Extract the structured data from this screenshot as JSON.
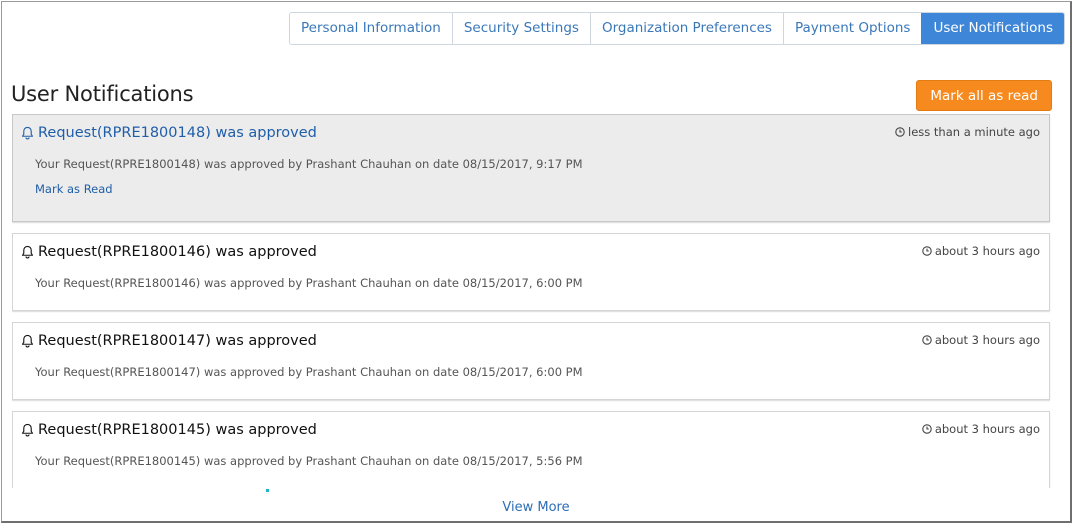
{
  "tabs": [
    {
      "label": "Personal Information",
      "active": false
    },
    {
      "label": "Security Settings",
      "active": false
    },
    {
      "label": "Organization Preferences",
      "active": false
    },
    {
      "label": "Payment Options",
      "active": false
    },
    {
      "label": "User Notifications",
      "active": true
    }
  ],
  "page": {
    "title": "User Notifications",
    "mark_all_label": "Mark all as read",
    "view_more_label": "View More"
  },
  "colors": {
    "accent_blue": "#3d86d8",
    "button_orange": "#f68a1f",
    "unread_bg": "#ececec",
    "link_blue": "#1f5ea8"
  },
  "notifications": [
    {
      "icon": "bell-icon",
      "title": "Request(RPRE1800148) was approved",
      "time": "less than a minute ago",
      "body": "Your Request(RPRE1800148) was approved by Prashant Chauhan on date 08/15/2017, 9:17 PM",
      "unread": true,
      "action": "Mark as Read"
    },
    {
      "icon": "bell-icon",
      "title": "Request(RPRE1800146) was approved",
      "time": "about 3 hours ago",
      "body": "Your Request(RPRE1800146) was approved by Prashant Chauhan on date 08/15/2017, 6:00 PM",
      "unread": false
    },
    {
      "icon": "bell-icon",
      "title": "Request(RPRE1800147) was approved",
      "time": "about 3 hours ago",
      "body": "Your Request(RPRE1800147) was approved by Prashant Chauhan on date 08/15/2017, 6:00 PM",
      "unread": false
    },
    {
      "icon": "bell-icon",
      "title": "Request(RPRE1800145) was approved",
      "time": "about 3 hours ago",
      "body": "Your Request(RPRE1800145) was approved by Prashant Chauhan on date 08/15/2017, 5:56 PM",
      "unread": false
    }
  ]
}
